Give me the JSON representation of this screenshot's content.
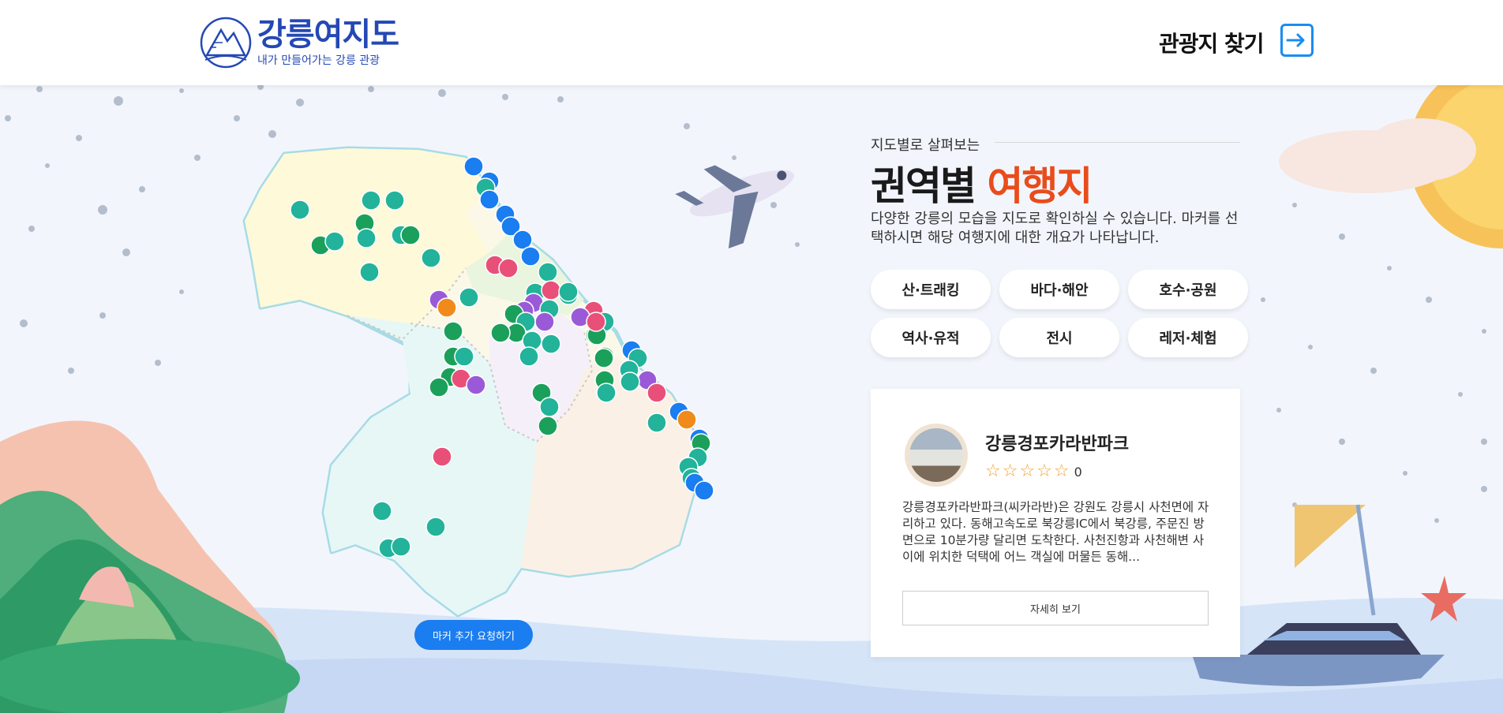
{
  "header": {
    "logo_title": "강릉여지도",
    "logo_subtitle": "내가 만들어가는 강릉 관광",
    "find_link": "관광지 찾기",
    "login_icon": "arrow-into-box-icon"
  },
  "section": {
    "eyebrow": "지도별로 살펴보는",
    "title_main": "권역별",
    "title_highlight": "여행지",
    "description": "다양한 강릉의 모습을 지도로 확인하실 수 있습니다. 마커를 선택하시면 해당 여행지에 대한 개요가 나타납니다."
  },
  "categories": [
    "산·트래킹",
    "바다·해안",
    "호수·공원",
    "역사·유적",
    "전시",
    "레저·체험"
  ],
  "card": {
    "name": "강릉경포카라반파크",
    "stars": "☆☆☆☆☆",
    "rating_count": "0",
    "body": "강릉경포카라반파크(씨카라반)은 강원도 강릉시 사천면에 자리하고 있다. 동해고속도로 북강릉IC에서 북강릉, 주문진 방면으로 10분가량 달리면 도착한다. 사천진항과 사천해변 사이에 위치한 덕택에 어느 객실에 머물든 동해...",
    "more_button": "자세히 보기"
  },
  "map": {
    "request_button": "마커 추가 요청하기"
  },
  "colors": {
    "accent_orange": "#e94c1c",
    "brand_blue": "#2448b4",
    "button_blue": "#1a7df0",
    "marker_mountain": "#1aa05a",
    "marker_sea": "#1a7df0",
    "marker_leisure": "#22b39a",
    "marker_exhibit": "#e8507a",
    "marker_history": "#9a5ad8",
    "marker_lake": "#f08a1a"
  }
}
